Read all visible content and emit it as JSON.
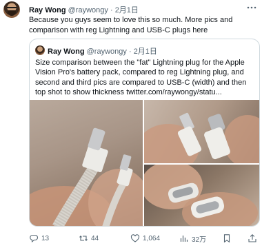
{
  "tweet": {
    "author_name": "Ray Wong",
    "author_handle": "@raywongy",
    "separator": "·",
    "date": "2月1日",
    "text": "Because you guys seem to love this so much. More pics and comparison with reg Lightning and USB-C plugs here"
  },
  "quote": {
    "author_name": "Ray Wong",
    "author_handle": "@raywongy",
    "separator": "·",
    "date": "2月1日",
    "text": "Size comparison between the \"fat\" Lightning plug for the Apple Vision Pro's battery pack, compared to reg Lightning plug, and second and third pics are compared to USB-C (width) and then top shot to show thickness  twitter.com/raywongy/statu..."
  },
  "actions": {
    "replies": "13",
    "retweets": "44",
    "likes": "1,064",
    "views": "32万"
  },
  "icons": {
    "more": "more-dots-icon",
    "reply": "reply-icon",
    "retweet": "retweet-icon",
    "like": "heart-icon",
    "views": "views-icon",
    "bookmark": "bookmark-icon",
    "share": "share-icon"
  },
  "colors": {
    "text_primary": "#0f1419",
    "text_secondary": "#536471",
    "border": "#cfd9de"
  }
}
